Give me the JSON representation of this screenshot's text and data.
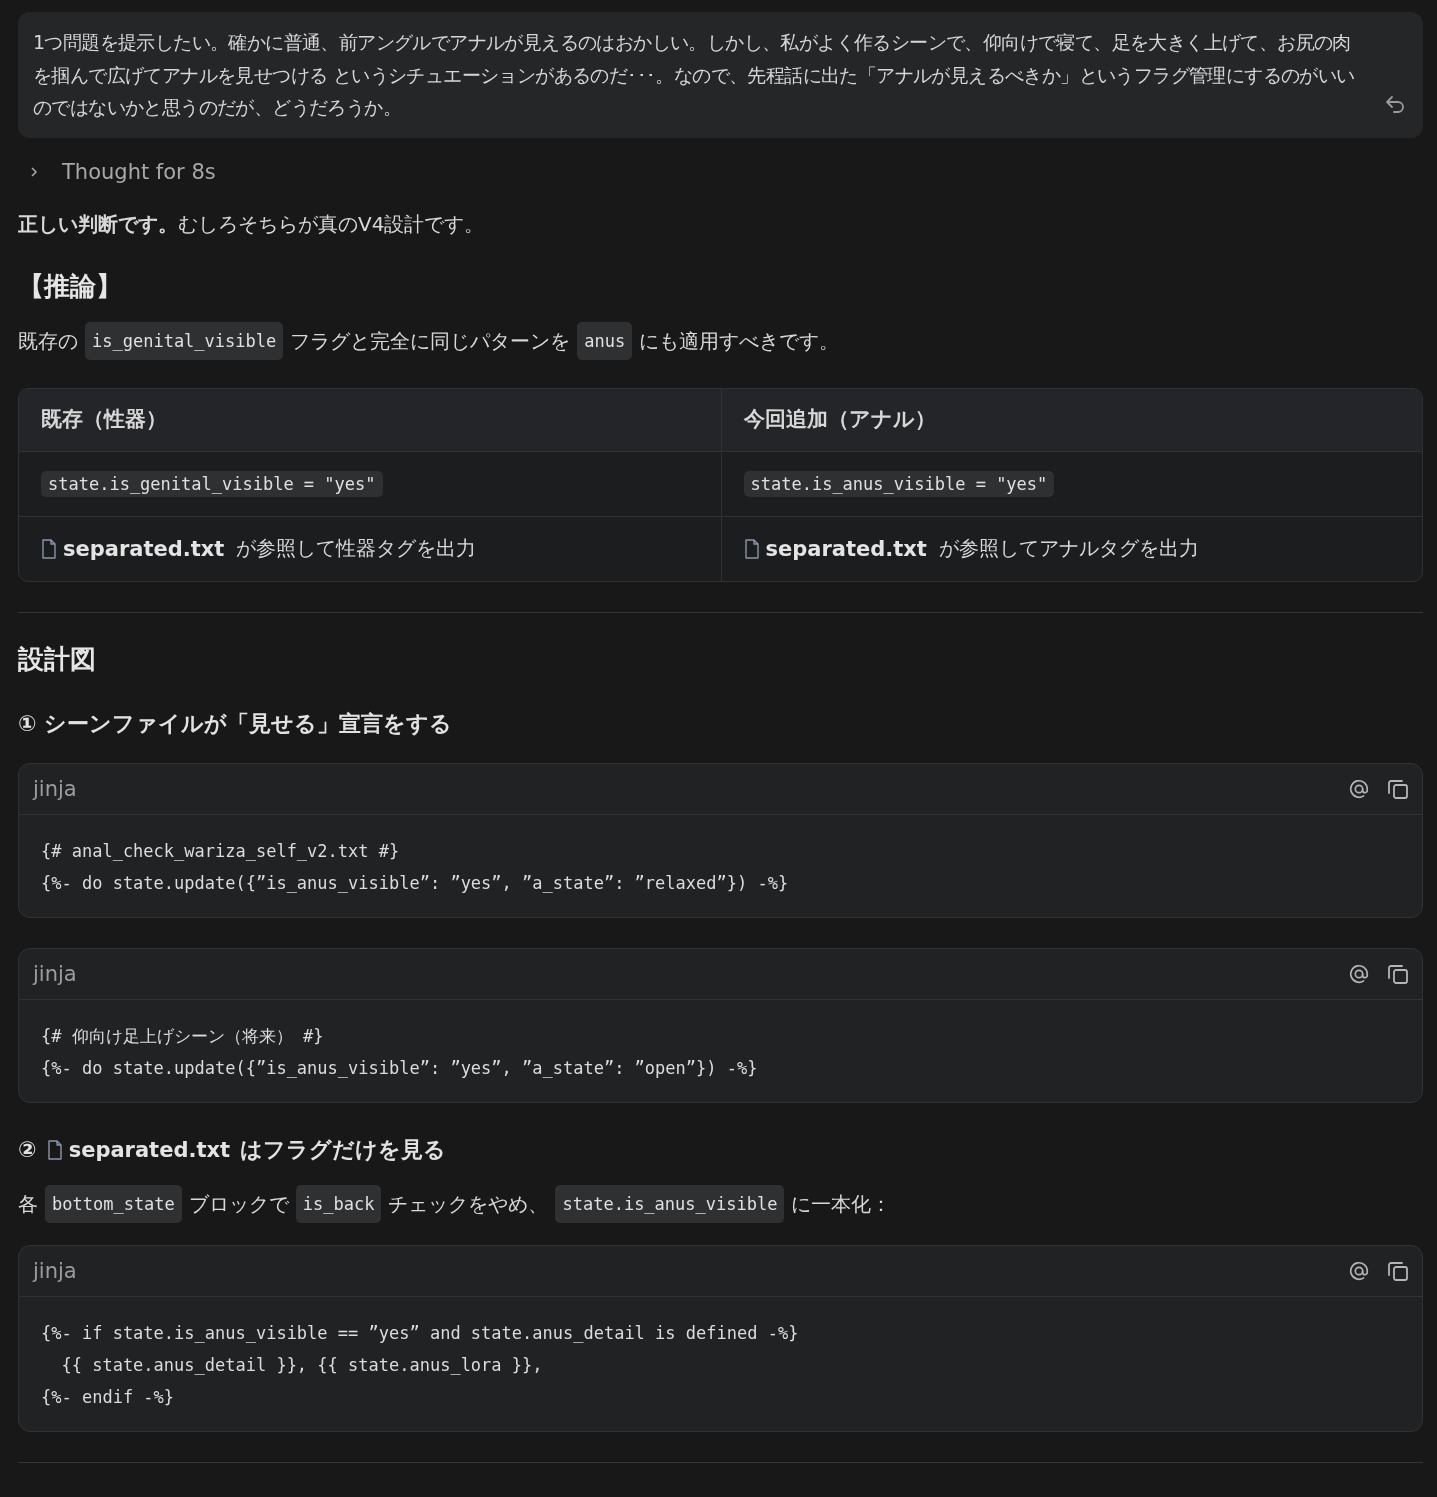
{
  "user_message": {
    "text": "1つ問題を提示したい。確かに普通、前アングルでアナルが見えるのはおかしい。しかし、私がよく作るシーンで、仰向けで寝て、足を大きく上げて、お尻の肉を掴んで広げてアナルを見せつける というシチュエーションがあるのだ･･･。なので、先程話に出た「アナルが見えるべきか」というフラグ管理にするのがいいのではないかと思うのだが、どうだろうか。"
  },
  "thought": {
    "label": "Thought for 8s",
    "expanded": false
  },
  "response": [
    {
      "kind": "paragraph",
      "text": "**正しい判断です。**むしろそちらが真のV4設計です。"
    },
    {
      "kind": "heading",
      "text": "【推論】"
    },
    {
      "kind": "inline",
      "segments": [
        {
          "kind": "text",
          "text": "既存の"
        },
        {
          "kind": "code",
          "text": "is_genital_visible"
        },
        {
          "kind": "text",
          "text": "フラグと完全に同じパターンを"
        },
        {
          "kind": "code",
          "text": "anus"
        },
        {
          "kind": "text",
          "text": "にも適用すべきです。"
        }
      ]
    },
    {
      "kind": "table",
      "columns": [
        "既存（性器）",
        "今回追加（アナル）"
      ],
      "rows": [
        [
          [
            {
              "kind": "code",
              "text": "state.is_genital_visible = \"yes\""
            }
          ],
          [
            {
              "kind": "code",
              "text": "state.is_anus_visible = \"yes\""
            }
          ]
        ],
        [
          [
            {
              "kind": "file",
              "text": "separated.txt"
            },
            {
              "kind": "text",
              "text": "が参照して性器タグを出力"
            }
          ],
          [
            {
              "kind": "file",
              "text": "separated.txt"
            },
            {
              "kind": "text",
              "text": "が参照してアナルタグを出力"
            }
          ]
        ]
      ]
    },
    {
      "kind": "rule"
    },
    {
      "kind": "heading",
      "text": "設計図"
    },
    {
      "kind": "subheading",
      "segments": [
        {
          "kind": "text",
          "text": "① シーンファイルが「見せる」宣言をする"
        }
      ]
    },
    {
      "kind": "codeblock",
      "language": "jinja",
      "lines": [
        "{# anal_check_wariza_self_v2.txt #}",
        "{%- do state.update({”is_anus_visible”: ”yes”, ”a_state”: ”relaxed”}) -%}"
      ]
    },
    {
      "kind": "codeblock",
      "language": "jinja",
      "lines": [
        "{# 仰向け足上げシーン（将来） #}",
        "{%- do state.update({”is_anus_visible”: ”yes”, ”a_state”: ”open”}) -%}"
      ]
    },
    {
      "kind": "subheading",
      "segments": [
        {
          "kind": "text",
          "text": "②"
        },
        {
          "kind": "file",
          "text": "separated.txt"
        },
        {
          "kind": "text",
          "text": "はフラグだけを見る"
        }
      ]
    },
    {
      "kind": "inline",
      "segments": [
        {
          "kind": "text",
          "text": "各"
        },
        {
          "kind": "code",
          "text": "bottom_state"
        },
        {
          "kind": "text",
          "text": "ブロックで"
        },
        {
          "kind": "code",
          "text": "is_back"
        },
        {
          "kind": "text",
          "text": "チェックをやめ、"
        },
        {
          "kind": "code",
          "text": "state.is_anus_visible"
        },
        {
          "kind": "text",
          "text": "に一本化："
        }
      ]
    },
    {
      "kind": "codeblock",
      "language": "jinja",
      "lines": [
        "{%- if state.is_anus_visible == ”yes” and state.anus_detail is defined -%}",
        "  {{ state.anus_detail }}, {{ state.anus_lora }},",
        "{%- endif -%}"
      ]
    },
    {
      "kind": "rule"
    }
  ]
}
